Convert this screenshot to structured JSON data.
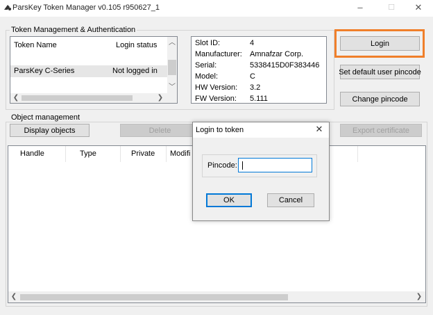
{
  "window": {
    "title": "ParsKey Token Manager v0.105 r950627_1",
    "minimize_glyph": "–",
    "maximize_glyph": "☐",
    "close_glyph": "✕"
  },
  "token_group": {
    "title": "Token Management & Authentication",
    "columns": [
      "Token Name",
      "Login status"
    ],
    "rows": [
      {
        "name": "ParsKey C-Series",
        "status": "Not logged in"
      }
    ]
  },
  "token_info": [
    {
      "label": "Slot ID:",
      "value": "4"
    },
    {
      "label": "Manufacturer:",
      "value": "Amnafzar Corp."
    },
    {
      "label": "Serial:",
      "value": "5338415D0F383446"
    },
    {
      "label": "Model:",
      "value": "C"
    },
    {
      "label": "HW Version:",
      "value": "3.2"
    },
    {
      "label": "FW Version:",
      "value": "5.111"
    }
  ],
  "buttons": {
    "login": "Login",
    "set_default_pincode": "Set default user pincode",
    "change_pincode": "Change pincode",
    "display_objects": "Display objects",
    "delete": "Delete",
    "export_certificate": "Export certificate"
  },
  "object_group": {
    "title": "Object management",
    "columns": [
      "Handle",
      "Type",
      "Private",
      "Modifi"
    ]
  },
  "dialog": {
    "title": "Login to token",
    "pincode_label": "Pincode:",
    "pincode_value": "",
    "ok_label": "OK",
    "cancel_label": "Cancel",
    "close_glyph": "✕"
  },
  "colors": {
    "highlight": "#f07f2a",
    "focus_blue": "#0078d7"
  },
  "icons": {
    "scroll_left": "❮",
    "scroll_right": "❯",
    "scroll_up": "︿",
    "scroll_down": "﹀"
  }
}
